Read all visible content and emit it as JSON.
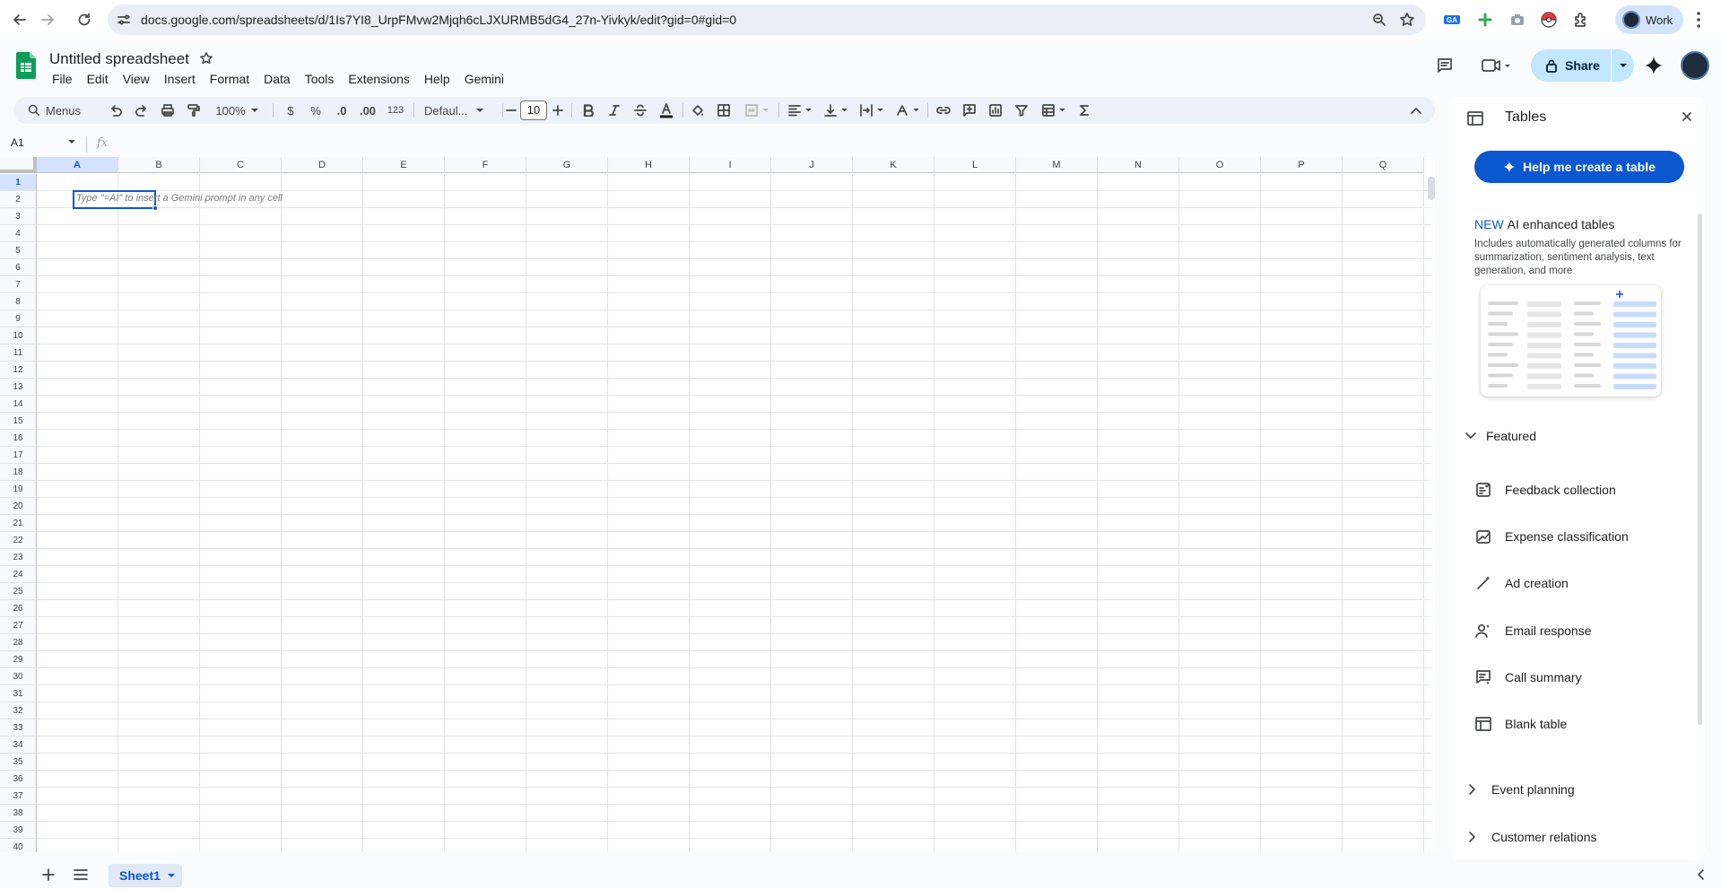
{
  "browser": {
    "url": "docs.google.com/spreadsheets/d/1Is7YI8_UrpFMvw2Mjqh6cLJXURMB5dG4_27n-Yivkyk/edit?gid=0#gid=0",
    "profile_label": "Work"
  },
  "doc": {
    "title": "Untitled spreadsheet",
    "menu": [
      "File",
      "Edit",
      "View",
      "Insert",
      "Format",
      "Data",
      "Tools",
      "Extensions",
      "Help",
      "Gemini"
    ],
    "share_label": "Share"
  },
  "toolbar": {
    "search_label": "Menus",
    "zoom": "100%",
    "currency": "$",
    "percent": "%",
    "dec_decrease": ".0",
    "dec_increase": ".00",
    "number_format": "123",
    "font": "Defaul...",
    "font_size": "10"
  },
  "formula_bar": {
    "cell_ref": "A1",
    "fx_label": "fx"
  },
  "grid": {
    "columns": [
      "A",
      "B",
      "C",
      "D",
      "E",
      "F",
      "G",
      "H",
      "I",
      "J",
      "K",
      "L",
      "M",
      "N",
      "O",
      "P",
      "Q"
    ],
    "rows": [
      "1",
      "2",
      "3",
      "4",
      "5",
      "6",
      "7",
      "8",
      "9",
      "10",
      "11",
      "12",
      "13",
      "14",
      "15",
      "16",
      "17",
      "18",
      "19",
      "20",
      "21",
      "22",
      "23",
      "24",
      "25",
      "26",
      "27",
      "28",
      "29",
      "30",
      "31",
      "32",
      "33",
      "34",
      "35",
      "36",
      "37",
      "38",
      "39",
      "40"
    ],
    "selected_column": "A",
    "selected_row": "1",
    "hint": "Type \"=AI\" to insert a Gemini prompt in any cell"
  },
  "sheets": {
    "active_tab": "Sheet1"
  },
  "panel": {
    "title": "Tables",
    "cta_label": "Help me create a table",
    "ai_badge": "NEW",
    "ai_heading": "AI enhanced tables",
    "ai_desc": "Includes automatically generated columns for summarization, sentiment analysis, text generation, and more",
    "featured_label": "Featured",
    "templates": [
      {
        "label": "Feedback collection",
        "icon": "feedback-icon"
      },
      {
        "label": "Expense classification",
        "icon": "chart-icon"
      },
      {
        "label": "Ad creation",
        "icon": "magic-wand-icon"
      },
      {
        "label": "Email response",
        "icon": "person-icon"
      },
      {
        "label": "Call summary",
        "icon": "summary-icon"
      },
      {
        "label": "Blank table",
        "icon": "table-icon"
      }
    ],
    "sections": [
      "Event planning",
      "Customer relations"
    ]
  },
  "colors": {
    "accent": "#0b57d0",
    "share_bg": "#c2e7ff",
    "selection_bg": "#d3e3fd",
    "toolbar_bg": "#edf2fa"
  }
}
